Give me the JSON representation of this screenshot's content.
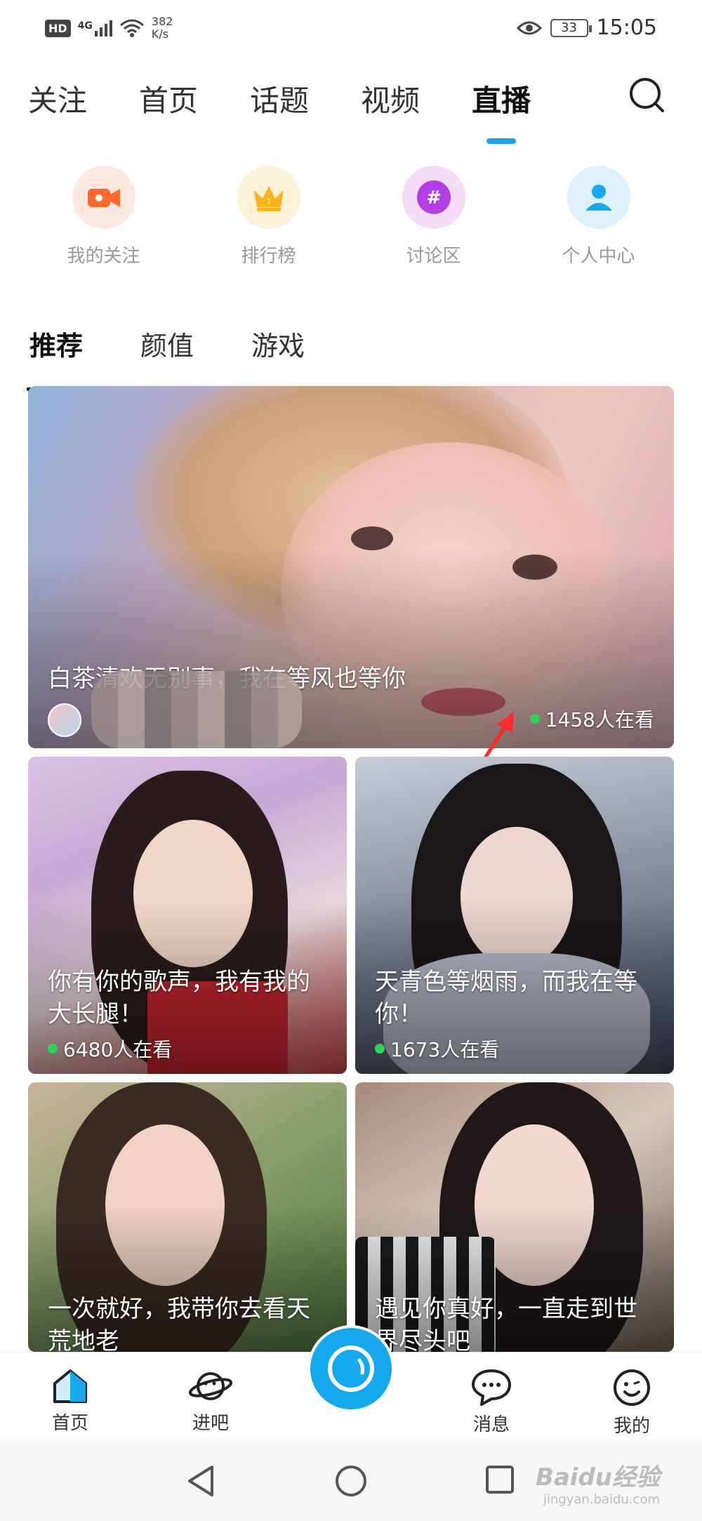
{
  "status_bar": {
    "hd": "HD",
    "signal": "4G",
    "speed_value": "382",
    "speed_unit": "K/s",
    "battery": "33",
    "time": "15:05"
  },
  "top_tabs": [
    {
      "label": "关注",
      "active": false
    },
    {
      "label": "首页",
      "active": false
    },
    {
      "label": "话题",
      "active": false
    },
    {
      "label": "视频",
      "active": false
    },
    {
      "label": "直播",
      "active": true
    }
  ],
  "quick_links": [
    {
      "label": "我的关注",
      "icon": "video-camera-icon",
      "color": "#ff6a2b",
      "bg": "#fde9df"
    },
    {
      "label": "排行榜",
      "icon": "crown-icon",
      "color": "#ffb21e",
      "bg": "#fdf1d8"
    },
    {
      "label": "讨论区",
      "icon": "hashtag-icon",
      "color": "#b23ee6",
      "bg": "#f6dcf9"
    },
    {
      "label": "个人中心",
      "icon": "person-icon",
      "color": "#18a8ee",
      "bg": "#dcf1fc"
    }
  ],
  "sub_tabs": [
    {
      "label": "推荐",
      "active": true
    },
    {
      "label": "颜值",
      "active": false
    },
    {
      "label": "游戏",
      "active": false
    }
  ],
  "featured": {
    "title": "白茶清欢无别事，我在等风也等你",
    "viewers": "1458人在看"
  },
  "cards": [
    {
      "title": "你有你的歌声，我有我的大长腿！",
      "viewers": "6480人在看"
    },
    {
      "title": "天青色等烟雨，而我在等你！",
      "viewers": "1673人在看"
    },
    {
      "title": "一次就好，我带你去看天荒地老",
      "viewers": ""
    },
    {
      "title": "遇见你真好，一直走到世界尽头吧",
      "viewers": ""
    }
  ],
  "bottom_nav": [
    {
      "label": "首页",
      "icon": "home-icon"
    },
    {
      "label": "进吧",
      "icon": "planet-icon"
    },
    {
      "label": "消息",
      "icon": "chat-bubble-icon"
    },
    {
      "label": "我的",
      "icon": "smiley-face-icon"
    }
  ],
  "watermark": {
    "brand": "Baidu经验",
    "url": "jingyan.baidu.com"
  },
  "colors": {
    "accent": "#1aa3ef",
    "live_dot": "#2fd35a"
  }
}
